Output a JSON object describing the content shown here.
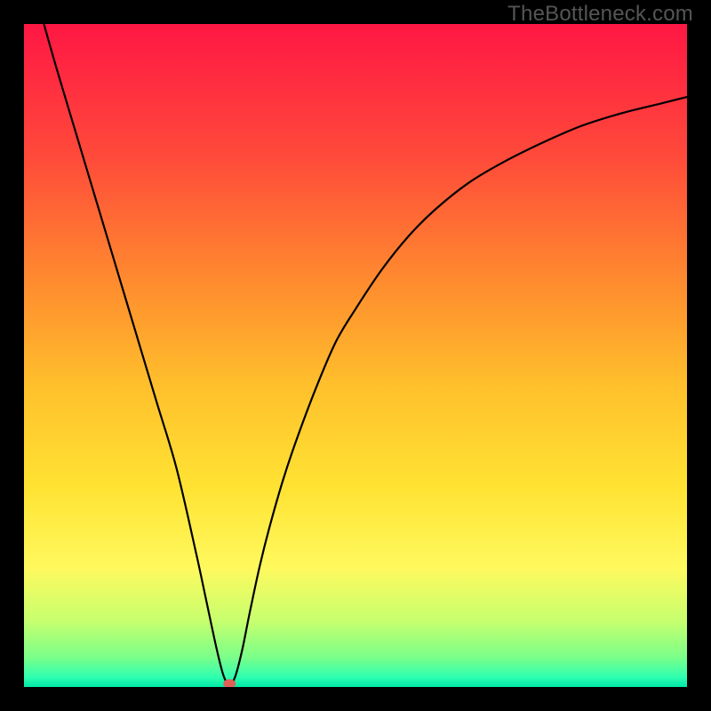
{
  "watermark": "TheBottleneck.com",
  "chart_data": {
    "type": "line",
    "title": "",
    "xlabel": "",
    "ylabel": "",
    "xlim": [
      0,
      100
    ],
    "ylim": [
      0,
      100
    ],
    "background": {
      "kind": "vertical-gradient",
      "stops": [
        {
          "pos": 0.0,
          "color": "#ff1744"
        },
        {
          "pos": 0.2,
          "color": "#ff4a3a"
        },
        {
          "pos": 0.4,
          "color": "#ff8f2e"
        },
        {
          "pos": 0.55,
          "color": "#ffc12c"
        },
        {
          "pos": 0.7,
          "color": "#ffe333"
        },
        {
          "pos": 0.82,
          "color": "#fff95e"
        },
        {
          "pos": 0.9,
          "color": "#c7ff6e"
        },
        {
          "pos": 0.955,
          "color": "#7bff88"
        },
        {
          "pos": 0.985,
          "color": "#2fffb0"
        },
        {
          "pos": 1.0,
          "color": "#00e8a8"
        }
      ]
    },
    "series": [
      {
        "name": "bottleneck-curve",
        "color": "#000000",
        "x": [
          3,
          5,
          8,
          11,
          14,
          17,
          20,
          23,
          26,
          27.5,
          29,
          30,
          30.7,
          31.3,
          32,
          33,
          34,
          35.5,
          37,
          39,
          41,
          44,
          47,
          50,
          54,
          58,
          62,
          67,
          72,
          78,
          84,
          90,
          96,
          100
        ],
        "y": [
          100,
          93,
          83,
          73,
          63,
          53,
          43,
          33,
          20,
          13,
          6,
          2,
          0.5,
          0.5,
          2,
          6,
          11,
          18,
          24,
          31,
          37,
          45,
          52,
          57,
          63,
          68,
          72,
          76,
          79,
          82,
          84.6,
          86.5,
          88,
          89
        ]
      }
    ],
    "marker": {
      "name": "optimum-point",
      "x": 31,
      "y": 0.5,
      "color": "#e06055"
    }
  }
}
